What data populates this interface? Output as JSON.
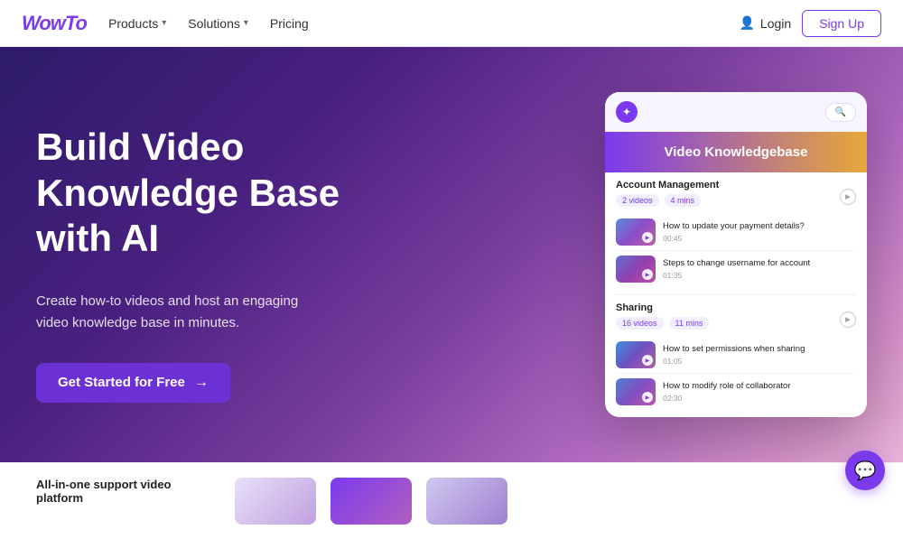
{
  "brand": {
    "logo_text": "WowTo",
    "logo_color": "#e040fb"
  },
  "navbar": {
    "products_label": "Products",
    "solutions_label": "Solutions",
    "pricing_label": "Pricing",
    "login_label": "Login",
    "signup_label": "Sign Up"
  },
  "hero": {
    "title": "Build Video Knowledge Base with AI",
    "description": "Create how-to videos and host an engaging video knowledge base in minutes.",
    "cta_label": "Get Started for Free"
  },
  "product_card": {
    "header_title": "Video Knowledgebase",
    "section1": {
      "title": "Account Management",
      "meta1": "2 videos",
      "meta2": "4 mins",
      "videos": [
        {
          "title": "How to update your payment details?",
          "duration": "00:45"
        },
        {
          "title": "Steps to change username for account",
          "duration": "01:35"
        }
      ]
    },
    "section2": {
      "title": "Sharing",
      "meta1": "16 videos",
      "meta2": "11 mins",
      "videos": [
        {
          "title": "How to set permissions when sharing",
          "duration": "01:05"
        },
        {
          "title": "How to modify role of collaborator",
          "duration": "02:30"
        }
      ]
    }
  },
  "bottom_strip": {
    "item1_title": "All-in-one support video platform"
  },
  "chat": {
    "icon": "💬"
  }
}
